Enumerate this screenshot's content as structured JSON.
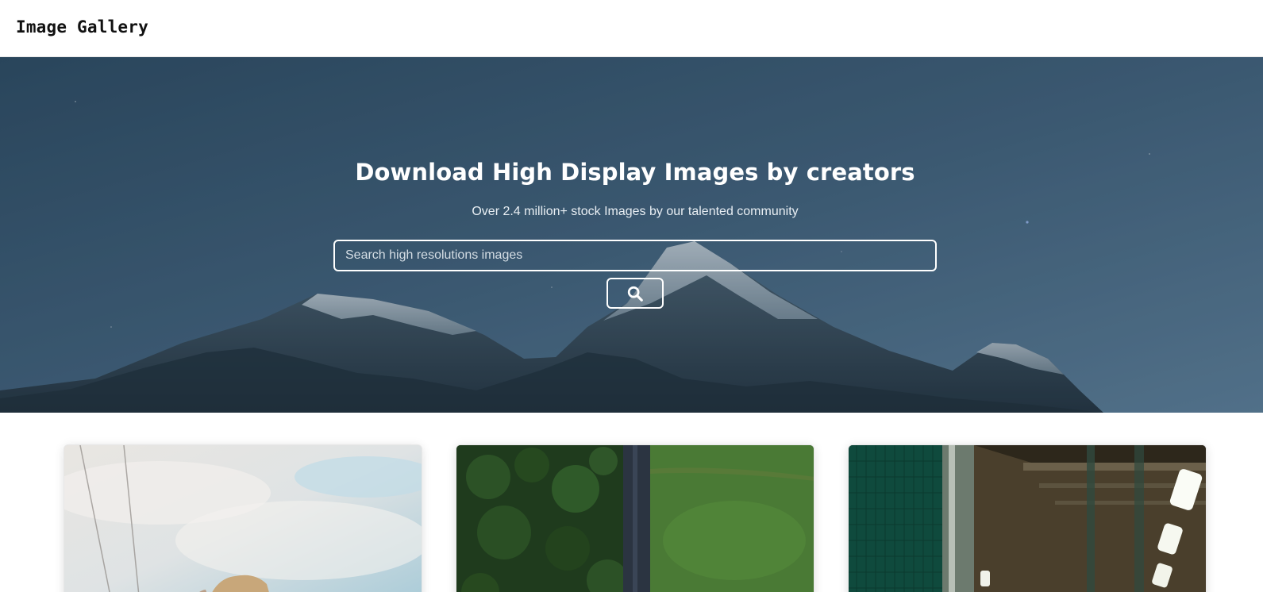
{
  "header": {
    "brand": "Image Gallery"
  },
  "hero": {
    "title": "Download High Display Images by creators",
    "subtitle": "Over 2.4 million+ stock Images by our talented community",
    "search": {
      "placeholder": "Search high resolutions images",
      "value": "",
      "button_icon": "search-icon"
    }
  },
  "gallery": {
    "cards": [
      {
        "subject": "person-photo"
      },
      {
        "subject": "forest-aerial-photo"
      },
      {
        "subject": "station-interior-photo"
      }
    ]
  },
  "colors": {
    "hero_sky": "#3e5c74",
    "header_bg": "#ffffff",
    "text_white": "#ffffff"
  }
}
